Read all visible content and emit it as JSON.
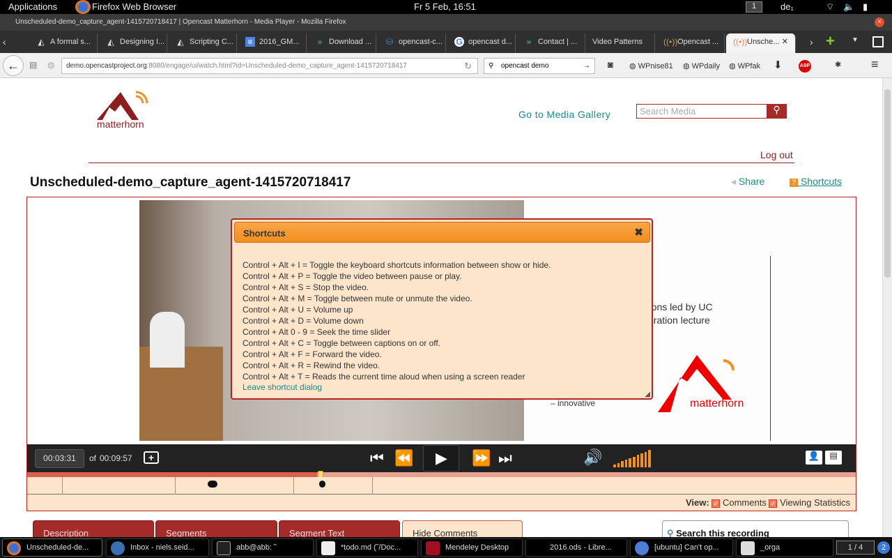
{
  "system": {
    "applications": "Applications",
    "browser": "Firefox Web Browser",
    "clock": "Fr 5 Feb, 16:51",
    "workspace": "1",
    "keyboard": "de₁"
  },
  "window_title": "Unscheduled-demo_capture_agent-1415720718417 | Opencast Matterhorn - Media Player - Mozilla Firefox",
  "tabs": [
    {
      "label": "A formal s..."
    },
    {
      "label": "Designing I..."
    },
    {
      "label": "Scripting C..."
    },
    {
      "label": "2016_GM..."
    },
    {
      "label": "Download ..."
    },
    {
      "label": "opencast-c..."
    },
    {
      "label": "opencast d..."
    },
    {
      "label": "Contact | ..."
    },
    {
      "label": "Video Patterns"
    },
    {
      "label": "Opencast ..."
    },
    {
      "label": "Unsche..."
    }
  ],
  "nav": {
    "url_host": "demo.opencastproject.org",
    "url_rest": ":8080/engage/ui/watch.html?id=Unscheduled-demo_capture_agent-1415720718417",
    "search": "opencast demo",
    "bookmarks": [
      "WPnise81",
      "WPdaily",
      "WPfak"
    ],
    "abp": "ABP"
  },
  "site": {
    "logo": "matterhorn",
    "gallery": "Go to Media Gallery",
    "search_placeholder": "Search Media",
    "logout": "Log out",
    "title": "Unscheduled-demo_capture_agent-1415720718417",
    "share": "Share",
    "shortcuts": "Shortcuts"
  },
  "slide": {
    "line1": "stitutions led by UC",
    "line2": "-generation lecture",
    "line3": "– innovative",
    "logo": "matterhorn"
  },
  "dialog": {
    "title": "Shortcuts",
    "lines": [
      "Control + Alt + I = Toggle the keyboard shortcuts information between show or hide.",
      "Control + Alt + P = Toggle the video between pause or play.",
      "Control + Alt + S = Stop the video.",
      "Control + Alt + M = Toggle between mute or unmute the video.",
      "Control + Alt + U = Volume up",
      "Control + Alt + D = Volume down",
      "Control + Alt 0 - 9 = Seek the time slider",
      "Control + Alt + C = Toggle between captions on or off.",
      "Control + Alt + F = Forward the video.",
      "Control + Alt + R = Rewind the video.",
      "Control + Alt + T = Reads the current time aloud when using a screen reader"
    ],
    "leave": "Leave shortcut dialog"
  },
  "player": {
    "current_time": "00:03:31",
    "of": "of",
    "duration": "00:09:57",
    "progress_percent": 35,
    "volume_level": 1.0
  },
  "view": {
    "label": "View:",
    "comments": "Comments",
    "stats": "Viewing Statistics",
    "comments_checked": true,
    "stats_checked": true
  },
  "bottom_tabs": [
    {
      "label": "Description"
    },
    {
      "label": "Segments"
    },
    {
      "label": "Segment Text"
    },
    {
      "label": "Hide Comments"
    }
  ],
  "search_recording": "Search this recording",
  "taskbar": [
    {
      "label": "Unscheduled-de..."
    },
    {
      "label": "Inbox - niels.seid..."
    },
    {
      "label": "abb@abb: ˜"
    },
    {
      "label": "*todo.md (˜/Doc..."
    },
    {
      "label": "Mendeley Desktop"
    },
    {
      "label": "2016.ods - Libre..."
    },
    {
      "label": "[ubuntu] Can't op..."
    },
    {
      "label": "_orga"
    }
  ],
  "pager": "1 / 4",
  "badge": "2",
  "colors": {
    "accent_red": "#a52a2a",
    "teal": "#1a8a8a",
    "dialog_bg": "#fde5cc",
    "orange": "#f39022"
  }
}
